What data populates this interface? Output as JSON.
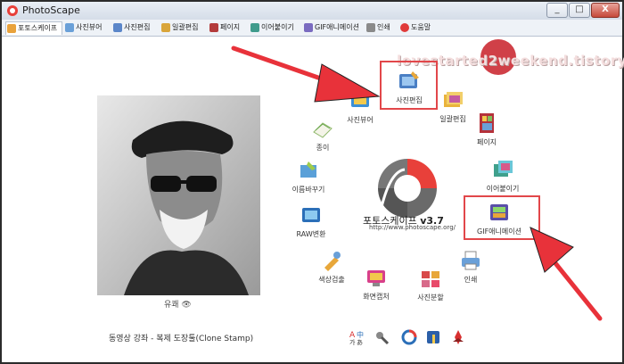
{
  "window": {
    "title": "PhotoScape",
    "minimize": "_",
    "maximize": "□",
    "close": "X"
  },
  "tabs": [
    {
      "label": "포토스케이프",
      "active": true
    },
    {
      "label": "사진뷰어"
    },
    {
      "label": "사진편집"
    },
    {
      "label": "일괄편집"
    },
    {
      "label": "페이지"
    },
    {
      "label": "이어붙이기"
    },
    {
      "label": "GIF애니메이션"
    },
    {
      "label": "인쇄"
    },
    {
      "label": "도움말"
    }
  ],
  "photo": {
    "actions": "유쾌 👁"
  },
  "caption": "동영상 강좌 - 복제 도장툴(Clone Stamp)",
  "watermark": "lovestarted2weekend.tistory",
  "logo": {
    "name": "포토스케이프",
    "version": "v3.7",
    "url": "http://www.photoscape.org/"
  },
  "menu": {
    "photo_edit": "사진편집",
    "photo_viewer": "사진뷰어",
    "batch_edit": "일괄편집",
    "paper": "종이",
    "page": "페이지",
    "rename": "이름바꾸기",
    "combine": "이어붙이기",
    "raw": "RAW변환",
    "gif": "GIF애니메이션",
    "color_picker": "색상검출",
    "print": "인쇄",
    "screen_capture": "화면캡처",
    "splitter": "사진분할"
  },
  "colors": {
    "highlight": "#e2474a",
    "arrow": "#e8323a",
    "logo_red": "#e8403a",
    "logo_gray": "#555555"
  }
}
